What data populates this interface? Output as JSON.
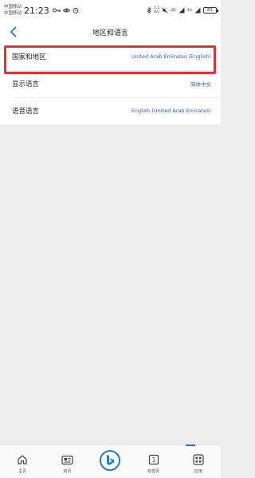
{
  "status_bar": {
    "carrier1": "中国移动",
    "carrier2": "中国移动",
    "time": "21:23",
    "net_speed_value": "1.5",
    "net_speed_unit": "K/s",
    "signal1_label": "4G",
    "signal2_label": "4G",
    "battery": "81"
  },
  "nav": {
    "title": "地区和语言"
  },
  "settings": {
    "rows": [
      {
        "label": "国家和地区",
        "value": "United Arab Emirates (English)"
      },
      {
        "label": "显示语言",
        "value": "简体中文"
      },
      {
        "label": "语音语言",
        "value": "English (United Arab Emirates)"
      }
    ]
  },
  "tabbar": {
    "tabs": [
      {
        "label": "主页",
        "icon": "home-icon"
      },
      {
        "label": "资讯",
        "icon": "news-icon"
      },
      {
        "label": "",
        "icon": "bing-icon"
      },
      {
        "label": "标签页",
        "icon": "tabs-icon",
        "count": "1"
      },
      {
        "label": "应用",
        "icon": "apps-icon"
      }
    ]
  },
  "colors": {
    "accent": "#2d5fb0",
    "highlight": "#d9353b",
    "background": "#ededed"
  }
}
